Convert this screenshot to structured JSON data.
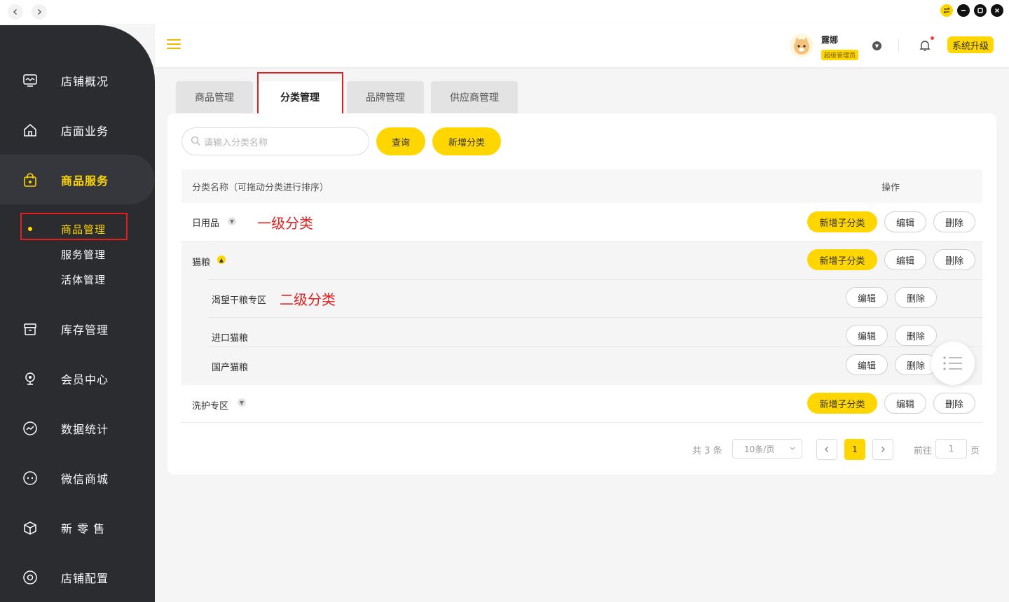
{
  "window": {
    "back_icon": "chevron-left-icon",
    "forward_icon": "chevron-right-icon",
    "controls": [
      "swap-icon",
      "minimize-icon",
      "maximize-icon",
      "close-icon"
    ]
  },
  "sidebar": {
    "items": [
      {
        "label": "店铺概况",
        "icon": "dashboard-icon"
      },
      {
        "label": "店面业务",
        "icon": "home-icon"
      },
      {
        "label": "商品服务",
        "icon": "shopping-bag-icon",
        "active": true
      },
      {
        "label": "库存管理",
        "icon": "archive-icon"
      },
      {
        "label": "会员中心",
        "icon": "member-icon"
      },
      {
        "label": "数据统计",
        "icon": "chart-icon"
      },
      {
        "label": "微信商城",
        "icon": "wechat-icon"
      },
      {
        "label": "新 零 售",
        "icon": "box-icon"
      },
      {
        "label": "店铺配置",
        "icon": "settings-icon"
      }
    ],
    "sub_items": [
      {
        "label": "商品管理",
        "active": true
      },
      {
        "label": "服务管理"
      },
      {
        "label": "活体管理"
      }
    ]
  },
  "header": {
    "user_name": "露娜",
    "user_role": "超级管理员",
    "upgrade_label": "系统升级"
  },
  "tabs": [
    {
      "label": "商品管理"
    },
    {
      "label": "分类管理",
      "active": true
    },
    {
      "label": "品牌管理"
    },
    {
      "label": "供应商管理"
    }
  ],
  "toolbar": {
    "search_placeholder": "请输入分类名称",
    "query_label": "查询",
    "add_category_label": "新增分类"
  },
  "table": {
    "col_name": "分类名称（可拖动分类进行排序）",
    "col_action": "操作",
    "add_sub_label": "新增子分类",
    "edit_label": "编辑",
    "delete_label": "删除",
    "rows": [
      {
        "name": "日用品",
        "level": 1,
        "expanded": false,
        "annotation": "一级分类"
      },
      {
        "name": "猫粮",
        "level": 1,
        "expanded": true
      },
      {
        "name": "渴望干粮专区",
        "level": 2,
        "annotation": "二级分类"
      },
      {
        "name": "进口猫粮",
        "level": 2
      },
      {
        "name": "国产猫粮",
        "level": 2
      },
      {
        "name": "洗护专区",
        "level": 1,
        "expanded": false
      }
    ]
  },
  "pagination": {
    "total": "共 3 条",
    "page_size": "10条/页",
    "current_page": "1",
    "goto_label": "前往",
    "goto_value": "1",
    "page_unit": "页"
  },
  "colors": {
    "accent": "#ffd600",
    "sidebar_bg": "#2b2c30",
    "annotation_red": "#e02020"
  }
}
